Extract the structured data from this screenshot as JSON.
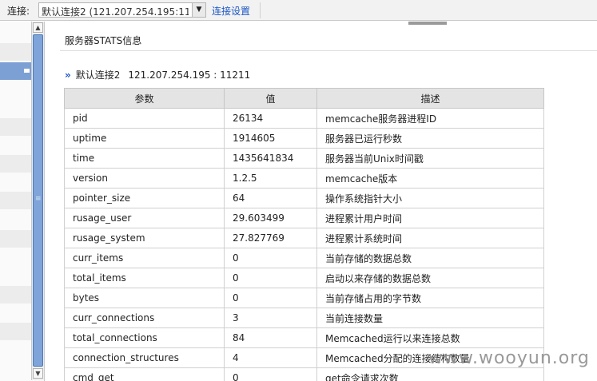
{
  "topbar": {
    "connection_label": "连接:",
    "connection_value": "默认连接2 (121.207.254.195:11",
    "dropdown_glyph": "▼",
    "settings_link": "连接设置"
  },
  "sidebar": {
    "selected_index": 3,
    "scroll_up_glyph": "▲",
    "scroll_down_glyph": "▼"
  },
  "main": {
    "title": "服务器STATS信息",
    "chevron_glyph": "»",
    "connection_name": "默认连接2",
    "connection_address": "121.207.254.195 : 11211"
  },
  "table": {
    "headers": [
      "参数",
      "值",
      "描述"
    ],
    "rows": [
      [
        "pid",
        "26134",
        "memcache服务器进程ID"
      ],
      [
        "uptime",
        "1914605",
        "服务器已运行秒数"
      ],
      [
        "time",
        "1435641834",
        "服务器当前Unix时间戳"
      ],
      [
        "version",
        "1.2.5",
        "memcache版本"
      ],
      [
        "pointer_size",
        "64",
        "操作系统指针大小"
      ],
      [
        "rusage_user",
        "29.603499",
        "进程累计用户时间"
      ],
      [
        "rusage_system",
        "27.827769",
        "进程累计系统时间"
      ],
      [
        "curr_items",
        "0",
        "当前存储的数据总数"
      ],
      [
        "total_items",
        "0",
        "启动以来存储的数据总数"
      ],
      [
        "bytes",
        "0",
        "当前存储占用的字节数"
      ],
      [
        "curr_connections",
        "3",
        "当前连接数量"
      ],
      [
        "total_connections",
        "84",
        "Memcached运行以来连接总数"
      ],
      [
        "connection_structures",
        "4",
        "Memcached分配的连接结构数量"
      ],
      [
        "cmd_get",
        "0",
        "get命令请求次数"
      ]
    ]
  },
  "watermark": "www.wooyun.org"
}
